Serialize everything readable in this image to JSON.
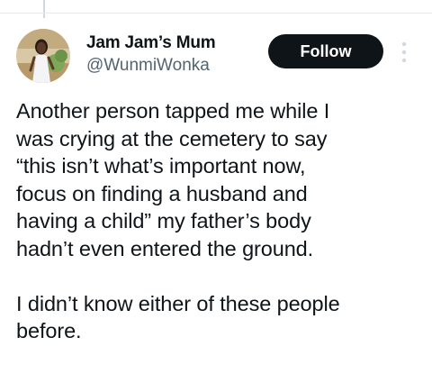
{
  "author": {
    "display_name": "Jam Jam’s Mum",
    "handle": "@WunmiWonka",
    "avatar_icon": "profile-photo"
  },
  "actions": {
    "follow_label": "Follow",
    "more_icon": "more-vertical-icon"
  },
  "tweet": {
    "text": "Another person tapped me while I\nwas crying at the cemetery to say\n“this isn’t what’s important now,\nfocus on finding a husband and\nhaving a child” my father’s body\nhadn’t even entered the ground.\n\nI didn’t know either of these people\nbefore."
  },
  "colors": {
    "text": "#0f1419",
    "secondary_text": "#536471",
    "button_bg": "#0f1419",
    "button_text": "#ffffff",
    "divider": "#e6e9eb"
  }
}
